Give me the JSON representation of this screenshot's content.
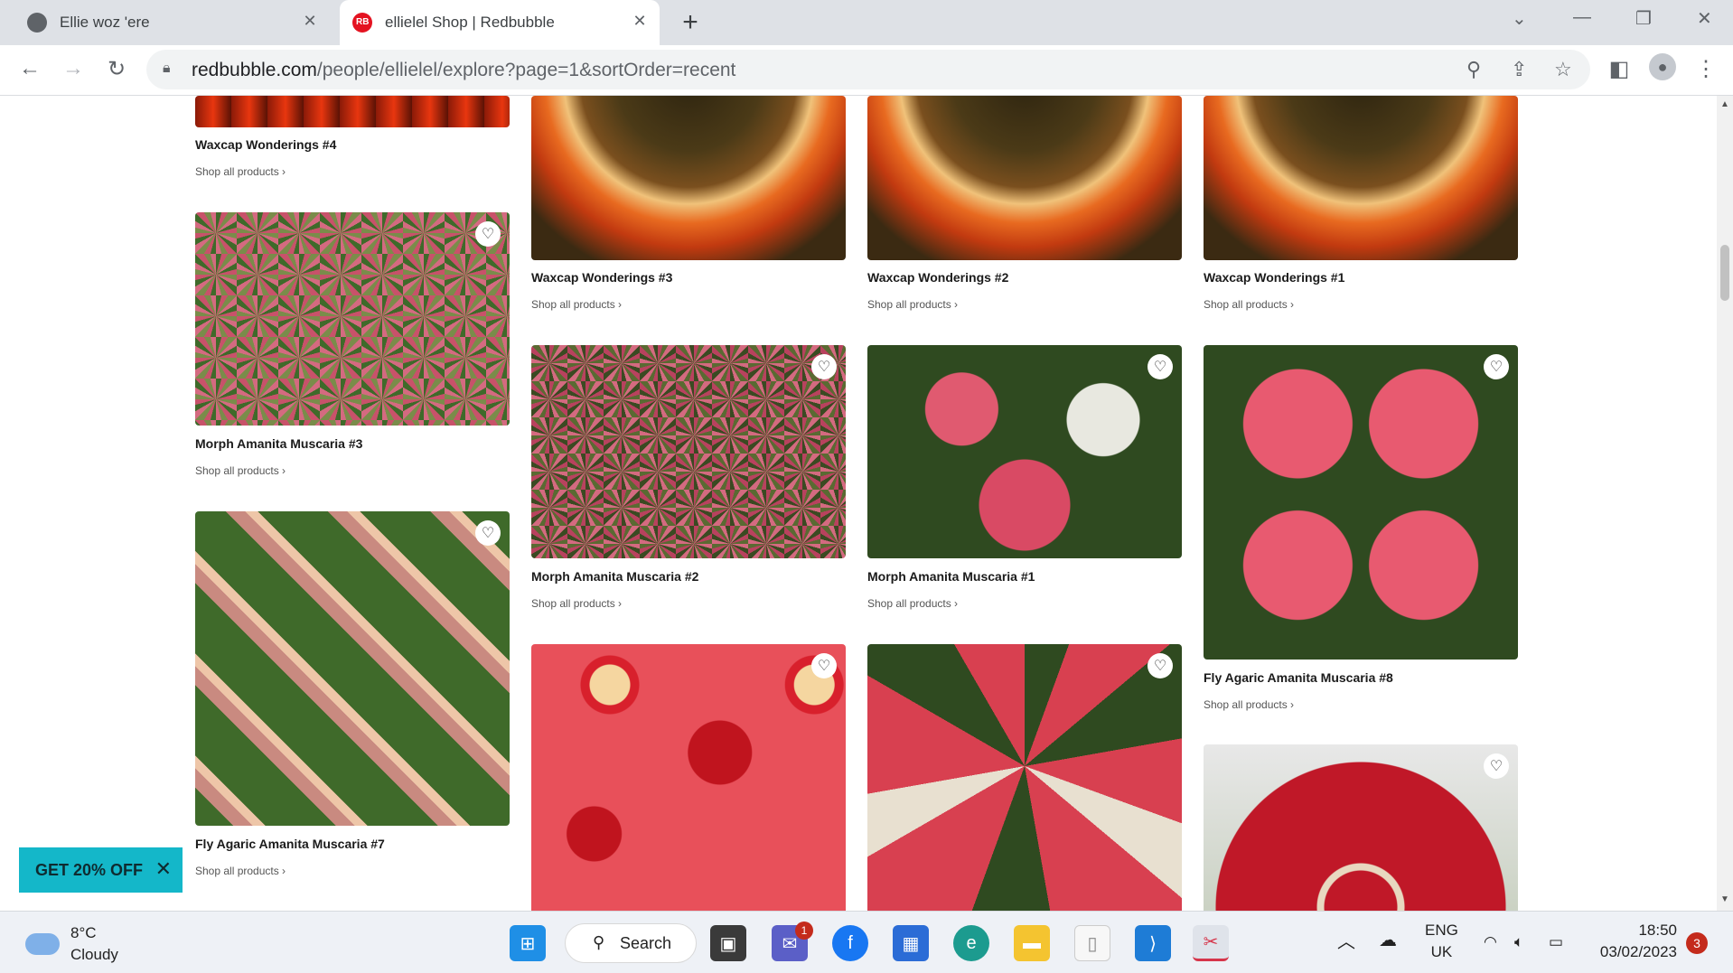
{
  "browser": {
    "tabs": [
      {
        "title": "Ellie woz 'ere",
        "close": "✕"
      },
      {
        "title": "ellielel Shop | Redbubble",
        "close": "✕"
      }
    ],
    "new_tab": "+",
    "url_domain": "redbubble.com",
    "url_path": "/people/ellielel/explore?page=1&sortOrder=recent"
  },
  "products": [
    {
      "title": "Waxcap Wonderings #4",
      "link": "Shop all products ›"
    },
    {
      "title": "Waxcap Wonderings #3",
      "link": "Shop all products ›"
    },
    {
      "title": "Waxcap Wonderings #2",
      "link": "Shop all products ›"
    },
    {
      "title": "Waxcap Wonderings #1",
      "link": "Shop all products ›"
    },
    {
      "title": "Morph Amanita Muscaria #3",
      "link": "Shop all products ›"
    },
    {
      "title": "Morph Amanita Muscaria #2",
      "link": "Shop all products ›"
    },
    {
      "title": "Morph Amanita Muscaria #1",
      "link": "Shop all products ›"
    },
    {
      "title": "Fly Agaric Amanita Muscaria #8",
      "link": "Shop all products ›"
    },
    {
      "title": "Fly Agaric Amanita Muscaria #7",
      "link": "Shop all products ›"
    }
  ],
  "promo": {
    "label": "GET 20% OFF",
    "close": "✕"
  },
  "taskbar": {
    "temp": "8°C",
    "condition": "Cloudy",
    "search": "Search",
    "teams_badge": "1",
    "lang1": "ENG",
    "lang2": "UK",
    "time": "18:50",
    "date": "03/02/2023",
    "notifications": "3"
  }
}
